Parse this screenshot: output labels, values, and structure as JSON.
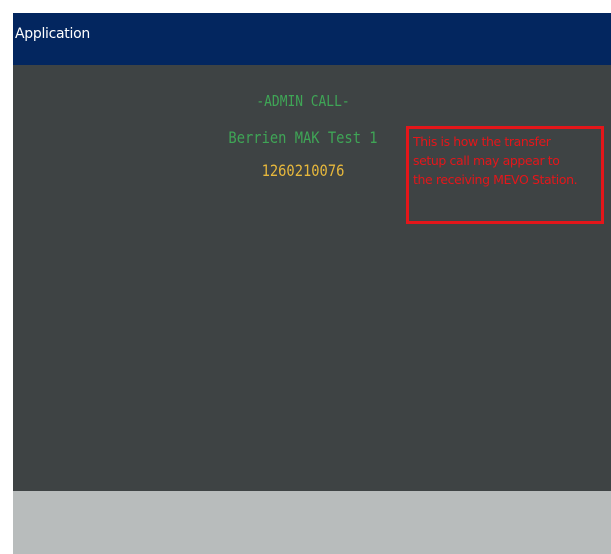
{
  "window": {
    "title": "Application"
  },
  "call": {
    "type": "-ADMIN CALL-",
    "caller_name": "Berrien MAK Test 1",
    "caller_number": "1260210076"
  },
  "annotation": {
    "lines": [
      "This is how the transfer",
      "setup call may appear to",
      "the receiving MEVO Station."
    ]
  },
  "colors": {
    "titlebar": "#03265f",
    "content_background": "#3e4344",
    "footer_background": "#b8bcbc",
    "call_text_green": "#3fa556",
    "number_text_yellow": "#e7b83c",
    "annotation_red": "#e4161a"
  }
}
